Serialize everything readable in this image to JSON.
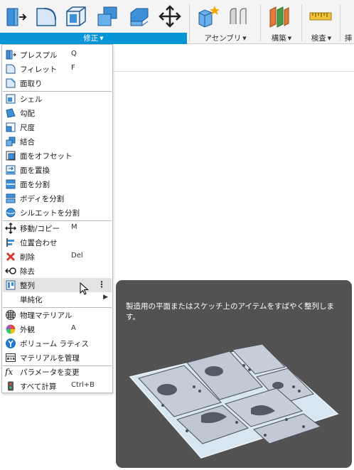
{
  "toolbar": {
    "groups": [
      {
        "label": "修正",
        "active": true
      },
      {
        "label": "アセンブリ",
        "active": false
      },
      {
        "label": "構築",
        "active": false
      },
      {
        "label": "検査",
        "active": false
      },
      {
        "label": "挿",
        "active": false
      }
    ],
    "icons": [
      "press-pull-icon",
      "fillet-icon",
      "shell-icon",
      "combine-icon",
      "offset-face-icon",
      "move-icon",
      "new-component-icon",
      "joint-icon",
      "construct-icon",
      "measure-icon"
    ]
  },
  "menu": {
    "items": [
      {
        "label": "プレスプル",
        "shortcut": "Q",
        "icon": "press-pull-icon"
      },
      {
        "label": "フィレット",
        "shortcut": "F",
        "icon": "fillet-icon"
      },
      {
        "label": "面取り",
        "shortcut": "",
        "icon": "chamfer-icon"
      },
      {
        "label": "シェル",
        "shortcut": "",
        "icon": "shell-icon"
      },
      {
        "label": "勾配",
        "shortcut": "",
        "icon": "draft-icon"
      },
      {
        "label": "尺度",
        "shortcut": "",
        "icon": "scale-icon"
      },
      {
        "label": "結合",
        "shortcut": "",
        "icon": "combine-icon"
      },
      {
        "label": "面をオフセット",
        "shortcut": "",
        "icon": "offset-face-icon"
      },
      {
        "label": "面を置換",
        "shortcut": "",
        "icon": "replace-face-icon"
      },
      {
        "label": "面を分割",
        "shortcut": "",
        "icon": "split-face-icon"
      },
      {
        "label": "ボディを分割",
        "shortcut": "",
        "icon": "split-body-icon"
      },
      {
        "label": "シルエットを分割",
        "shortcut": "",
        "icon": "silhouette-split-icon"
      },
      {
        "label": "移動/コピー",
        "shortcut": "M",
        "icon": "move-icon"
      },
      {
        "label": "位置合わせ",
        "shortcut": "",
        "icon": "align-icon"
      },
      {
        "label": "削除",
        "shortcut": "Del",
        "icon": "delete-icon"
      },
      {
        "label": "除去",
        "shortcut": "",
        "icon": "remove-icon"
      },
      {
        "label": "整列",
        "shortcut": "",
        "icon": "arrange-icon",
        "more": "⋮"
      },
      {
        "label": "単純化",
        "shortcut": "",
        "icon": "",
        "arrow": "▶"
      },
      {
        "label": "物理マテリアル",
        "shortcut": "",
        "icon": "physical-material-icon"
      },
      {
        "label": "外観",
        "shortcut": "A",
        "icon": "appearance-icon"
      },
      {
        "label": "ボリューム ラティス",
        "shortcut": "",
        "icon": "volumetric-lattice-icon"
      },
      {
        "label": "マテリアルを管理",
        "shortcut": "",
        "icon": "manage-materials-icon"
      },
      {
        "label": "パラメータを変更",
        "shortcut": "",
        "icon": "fx-icon"
      },
      {
        "label": "すべて計算",
        "shortcut": "Ctrl+B",
        "icon": "compute-all-icon"
      }
    ]
  },
  "tooltip": {
    "text": "製造用の平面またはスケッチ上のアイテムをすばやく整列します。"
  },
  "colors": {
    "accent": "#0696d7",
    "tooltip_bg": "#525252",
    "menu_hover": "#e3e3e3"
  }
}
